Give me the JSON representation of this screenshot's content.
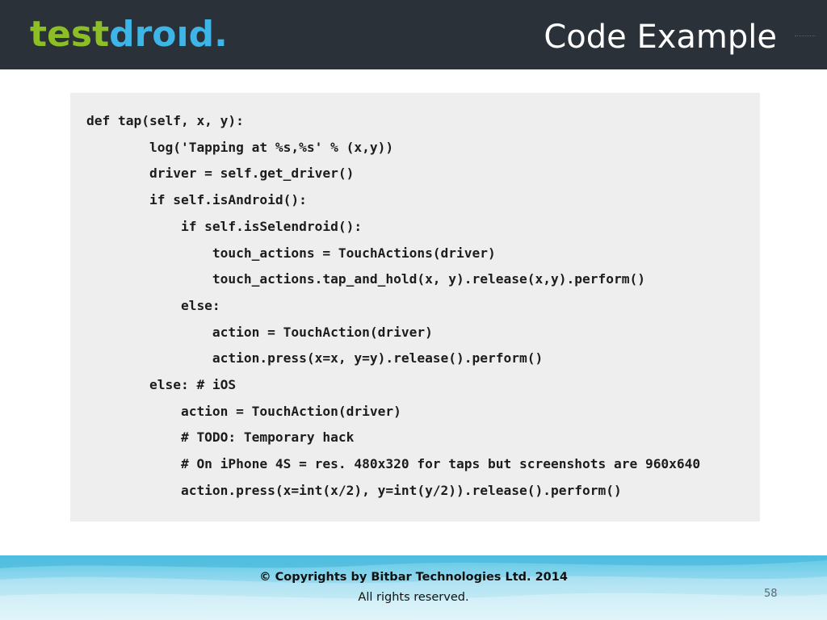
{
  "header": {
    "logo": {
      "part_a": "test",
      "part_b": "dro",
      "part_c": "ıd."
    },
    "title": "Code Example"
  },
  "code": {
    "language": "python",
    "lines": [
      "def tap(self, x, y):",
      "        log('Tapping at %s,%s' % (x,y))",
      "        driver = self.get_driver()",
      "        if self.isAndroid():",
      "            if self.isSelendroid():",
      "                touch_actions = TouchActions(driver)",
      "                touch_actions.tap_and_hold(x, y).release(x,y).perform()",
      "            else:",
      "                action = TouchAction(driver)",
      "                action.press(x=x, y=y).release().perform()",
      "        else: # iOS",
      "            action = TouchAction(driver)",
      "            # TODO: Temporary hack",
      "            # On iPhone 4S = res. 480x320 for taps but screenshots are 960x640",
      "            action.press(x=int(x/2), y=int(y/2)).release().perform()"
    ]
  },
  "footer": {
    "copyright": "© Copyrights by Bitbar Technologies Ltd. 2014",
    "rights": "All rights reserved.",
    "slide_number": "58"
  },
  "colors": {
    "header_bg": "#2b3138",
    "logo_green": "#8cbf26",
    "logo_blue": "#3db5e6",
    "code_bg": "#eeeeee",
    "footer_blue": "#5ec8e6"
  }
}
